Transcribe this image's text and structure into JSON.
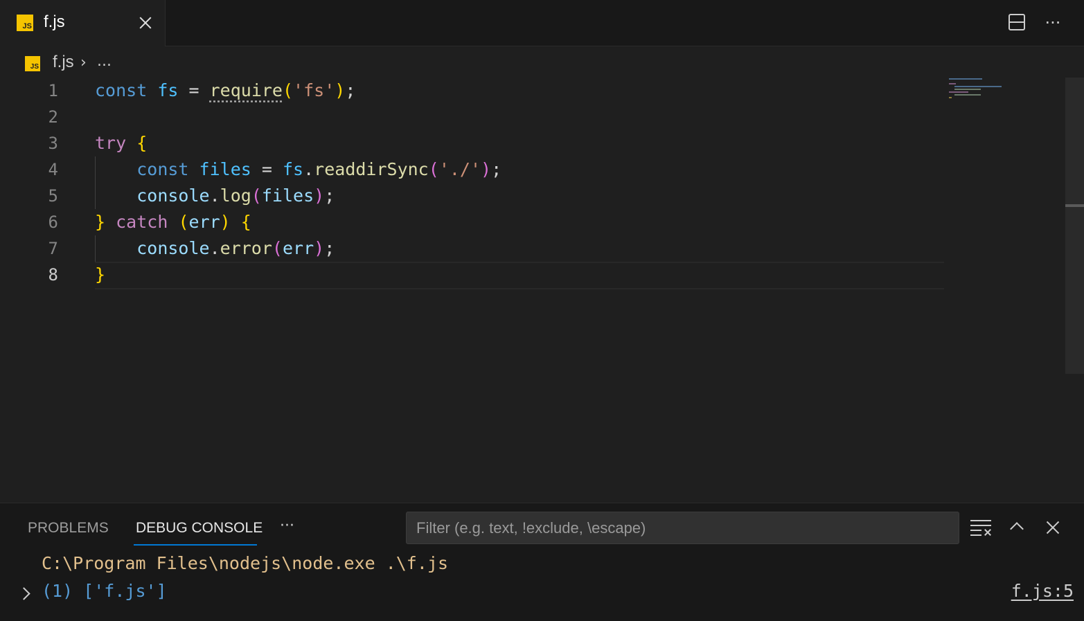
{
  "tab": {
    "label": "f.js",
    "badge": "JS"
  },
  "breadcrumb": {
    "file": "f.js",
    "separator": "›",
    "ellipsis": "..."
  },
  "toolbar": {
    "more_label": "···"
  },
  "editor": {
    "active_line": 8,
    "line_numbers": [
      "1",
      "2",
      "3",
      "4",
      "5",
      "6",
      "7",
      "8"
    ],
    "lines": [
      "const fs = require('fs');",
      "",
      "try {",
      "    const files = fs.readdirSync('./');",
      "    console.log(files);",
      "} catch (err) {",
      "    console.error(err);",
      "}"
    ]
  },
  "panel": {
    "tabs": [
      "PROBLEMS",
      "DEBUG CONSOLE"
    ],
    "active_tab": "DEBUG CONSOLE",
    "more_label": "···",
    "filter_placeholder": "Filter (e.g. text, !exclude, \\escape)",
    "output": {
      "command": "C:\\Program Files\\nodejs\\node.exe .\\f.js",
      "value": "(1) ['f.js']",
      "source": "f.js:5"
    }
  },
  "colors": {
    "background": "#1f1f1f",
    "keyword": "#569cd6",
    "control": "#c586c0",
    "variable": "#9cdcfe",
    "function": "#dcdcaa",
    "string": "#ce9178",
    "accent": "#0078d4",
    "js_badge": "#f5c400"
  }
}
